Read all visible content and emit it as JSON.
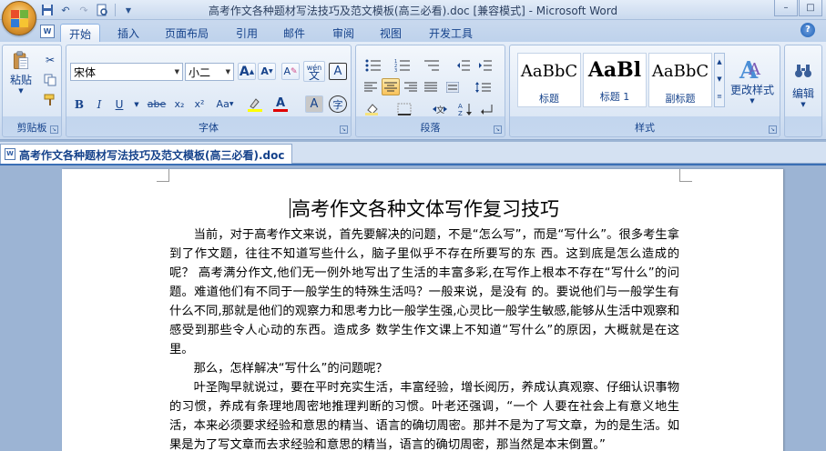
{
  "window": {
    "title": "高考作文各种题材写法技巧及范文模板(高三必看).doc [兼容模式] - Microsoft Word",
    "minimize": "–",
    "maximize": "□"
  },
  "qat": {
    "save_icon": "save-icon",
    "undo_icon": "undo-icon",
    "redo_icon": "redo-icon",
    "print_preview_icon": "print-preview-icon",
    "customize_icon": "dropdown-icon"
  },
  "tabs": [
    {
      "label": "开始"
    },
    {
      "label": "插入"
    },
    {
      "label": "页面布局"
    },
    {
      "label": "引用"
    },
    {
      "label": "邮件"
    },
    {
      "label": "审阅"
    },
    {
      "label": "视图"
    },
    {
      "label": "开发工具"
    }
  ],
  "ribbon": {
    "clipboard": {
      "paste_label": "粘贴",
      "group_label": "剪贴板"
    },
    "font": {
      "font_name": "宋体",
      "font_size": "小二",
      "grow_label": "A",
      "shrink_label": "A",
      "clear_label": "A",
      "phonetic_label": "wén",
      "phonetic_char": "文",
      "border_label": "A",
      "bold_label": "B",
      "italic_label": "I",
      "underline_label": "U",
      "strike_label": "abe",
      "sub_label": "x₂",
      "sup_label": "x²",
      "case_label": "Aa",
      "color_label": "A",
      "shade_label": "A",
      "enclose_label": "字",
      "group_label": "字体"
    },
    "paragraph": {
      "group_label": "段落"
    },
    "styles": {
      "items": [
        {
          "sample": "AaBbC",
          "caption": "标题"
        },
        {
          "sample": "AaBl",
          "caption": "标题 1"
        },
        {
          "sample": "AaBbC",
          "caption": "副标题"
        }
      ],
      "change_label": "更改样式",
      "group_label": "样式"
    },
    "editing": {
      "label": "编辑"
    }
  },
  "document_tab": {
    "label": "高考作文各种题材写法技巧及范文模板(高三必看).doc"
  },
  "document": {
    "title": "高考作文各种文体写作复习技巧",
    "paragraphs": [
      "当前，对于高考作文来说，首先要解决的问题，不是“怎么写”，而是“写什么”。很多考生拿到了作文题，往往不知道写些什么，脑子里似乎不存在所要写的东 西。这到底是怎么造成的呢？ 高考满分作文,他们无一例外地写出了生活的丰富多彩,在写作上根本不存在“写什么”的问题。难道他们有不同于一般学生的特殊生活吗？一般来说，是没有 的。要说他们与一般学生有什么不同,那就是他们的观察力和思考力比一般学生强,心灵比一般学生敏感,能够从生活中观察和感受到那些令人心动的东西。造成多 数学生作文课上不知道“写什么”的原因，大概就是在这里。",
      "那么，怎样解决“写什么”的问题呢？",
      "叶圣陶早就说过，要在平时充实生活，丰富经验，增长阅历，养成认真观察、仔细认识事物的习惯，养成有条理地周密地推理判断的习惯。叶老还强调，“一个 人要在社会上有意义地生活，本来必须要求经验和意思的精当、语言的确切周密。那并不是为了写文章，为的是生活。如果是为了写文章而去求经验和意思的精当，语言的确切周密，那当然是本末倒置。”"
    ]
  }
}
